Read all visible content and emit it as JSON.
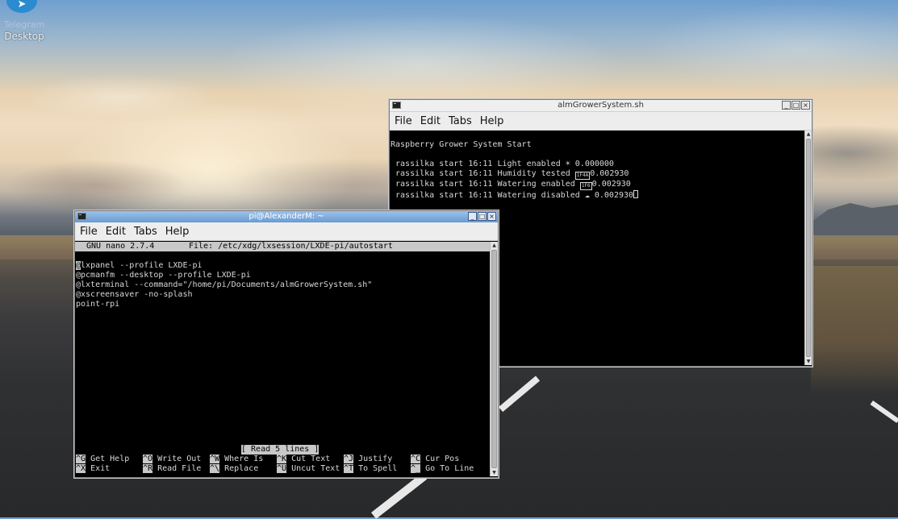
{
  "desktop": {
    "icon_label": "Desktop",
    "icon_faded_label": "Telegram"
  },
  "grower_window": {
    "title": "almGrowerSystem.sh",
    "menu": [
      "File",
      "Edit",
      "Tabs",
      "Help"
    ],
    "lines": [
      "Raspberry Grower System Start",
      "",
      " rassilka start 16:11 Light enabled ☀ 0.000000",
      " rassilka start 16:11 Humidity tested ",
      " rassilka start 16:11 Watering enabled ",
      " rassilka start 16:11 Watering disabled ☁ 0.002930"
    ],
    "line3_value": "0.002930",
    "line4_value": "0.002930",
    "glyph_a": "1F4A",
    "glyph_b": "1F6"
  },
  "nano_window": {
    "title": "pi@AlexanderM: ~",
    "menu": [
      "File",
      "Edit",
      "Tabs",
      "Help"
    ],
    "header_left": "GNU nano 2.7.4",
    "header_file": "File: /etc/xdg/lxsession/LXDE-pi/autostart",
    "first_char": "@",
    "first_line_rest": "lxpanel --profile LXDE-pi",
    "lines": [
      "@pcmanfm --desktop --profile LXDE-pi",
      "@lxterminal --command=\"/home/pi/Documents/almGrowerSystem.sh\"",
      "@xscreensaver -no-splash",
      "point-rpi"
    ],
    "status": "[ Read 5 lines ]",
    "shortcuts_row1": [
      {
        "key": "^G",
        "label": "Get Help"
      },
      {
        "key": "^O",
        "label": "Write Out"
      },
      {
        "key": "^W",
        "label": "Where Is"
      },
      {
        "key": "^K",
        "label": "Cut Text"
      },
      {
        "key": "^J",
        "label": "Justify"
      },
      {
        "key": "^C",
        "label": "Cur Pos"
      }
    ],
    "shortcuts_row2": [
      {
        "key": "^X",
        "label": "Exit"
      },
      {
        "key": "^R",
        "label": "Read File"
      },
      {
        "key": "^\\",
        "label": "Replace"
      },
      {
        "key": "^U",
        "label": "Uncut Text"
      },
      {
        "key": "^T",
        "label": "To Spell"
      },
      {
        "key": "^_",
        "label": "Go To Line"
      }
    ]
  }
}
